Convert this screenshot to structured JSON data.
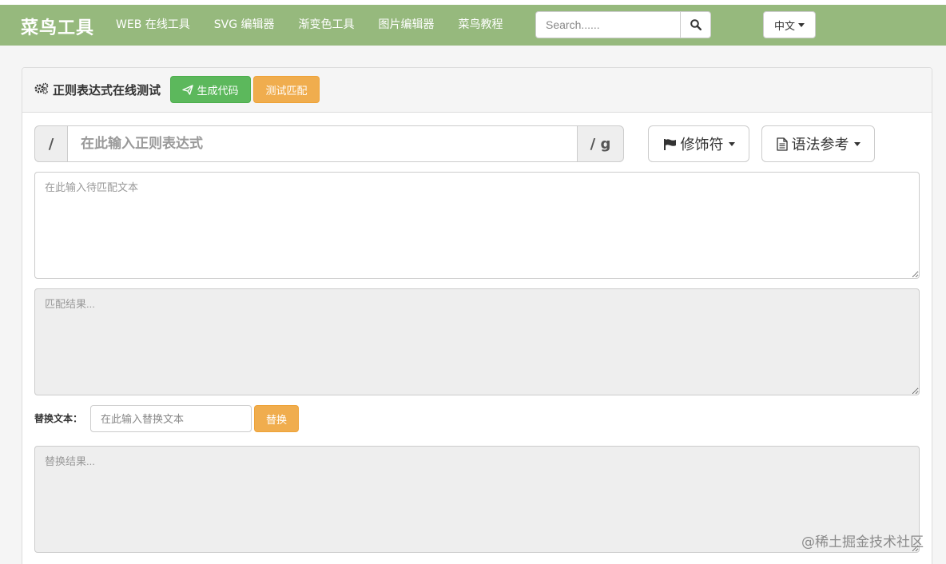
{
  "navbar": {
    "brand": "菜鸟工具",
    "links": [
      "WEB 在线工具",
      "SVG 编辑器",
      "渐变色工具",
      "图片编辑器",
      "菜鸟教程"
    ],
    "search_placeholder": "Search......",
    "language": "中文",
    "background_color": "#96b97d"
  },
  "panel": {
    "title": "正则表达式在线测试",
    "generate_code_label": "生成代码",
    "test_match_label": "测试匹配"
  },
  "regex": {
    "prefix": "/",
    "placeholder": "在此输入正则表达式",
    "flags": "/ g",
    "modifier_label": "修饰符",
    "syntax_label": "语法参考"
  },
  "input_text": {
    "placeholder": "在此输入待匹配文本"
  },
  "match_result": {
    "placeholder": "匹配结果..."
  },
  "replace": {
    "label": "替换文本：",
    "placeholder": "在此输入替换文本",
    "button_label": "替换",
    "result_placeholder": "替换结果..."
  },
  "watermark": "@稀土掘金技术社区",
  "colors": {
    "success": "#5cb85c",
    "warning": "#f0ad4e"
  },
  "icons": [
    "search-icon",
    "gears-icon",
    "paper-plane-icon",
    "flag-icon",
    "file-text-icon",
    "chevron-down-icon"
  ]
}
